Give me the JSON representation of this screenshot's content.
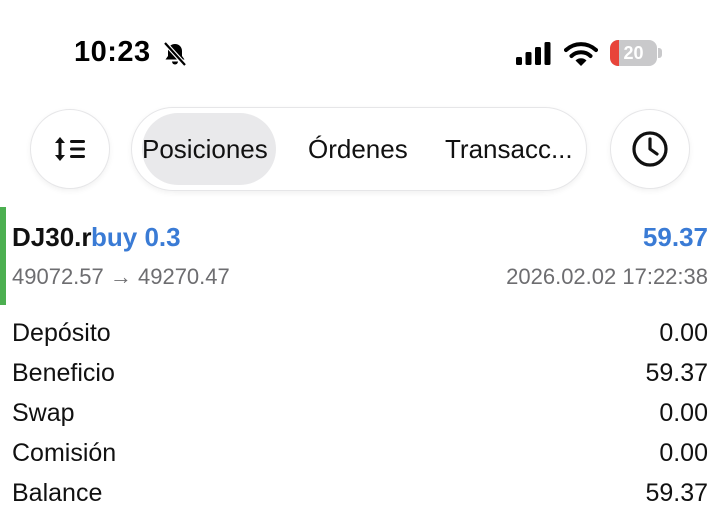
{
  "status_bar": {
    "time": "10:23",
    "battery_level": "20",
    "battery_fraction": 0.2,
    "icons": [
      "bell-slash-icon",
      "cellular-signal-icon",
      "wifi-icon",
      "battery-icon"
    ]
  },
  "toolbar": {
    "sort_icon": "sort-list-icon",
    "history_icon": "clock-icon",
    "tabs": [
      {
        "label": "Posiciones",
        "active": true
      },
      {
        "label": "Órdenes",
        "active": false
      },
      {
        "label": "Transacc...",
        "active": false
      }
    ]
  },
  "position": {
    "symbol": "DJ30.r",
    "side": "buy 0.3",
    "profit": "59.37",
    "prices": "49072.57 → 49270.47",
    "datetime": "2026.02.02 17:22:38",
    "accent_color": "#4caf50",
    "profit_color": "#3a7bd5"
  },
  "details": [
    {
      "label": "Depósito",
      "value": "0.00"
    },
    {
      "label": "Beneficio",
      "value": "59.37"
    },
    {
      "label": "Swap",
      "value": "0.00"
    },
    {
      "label": "Comisión",
      "value": "0.00"
    },
    {
      "label": "Balance",
      "value": "59.37"
    }
  ]
}
